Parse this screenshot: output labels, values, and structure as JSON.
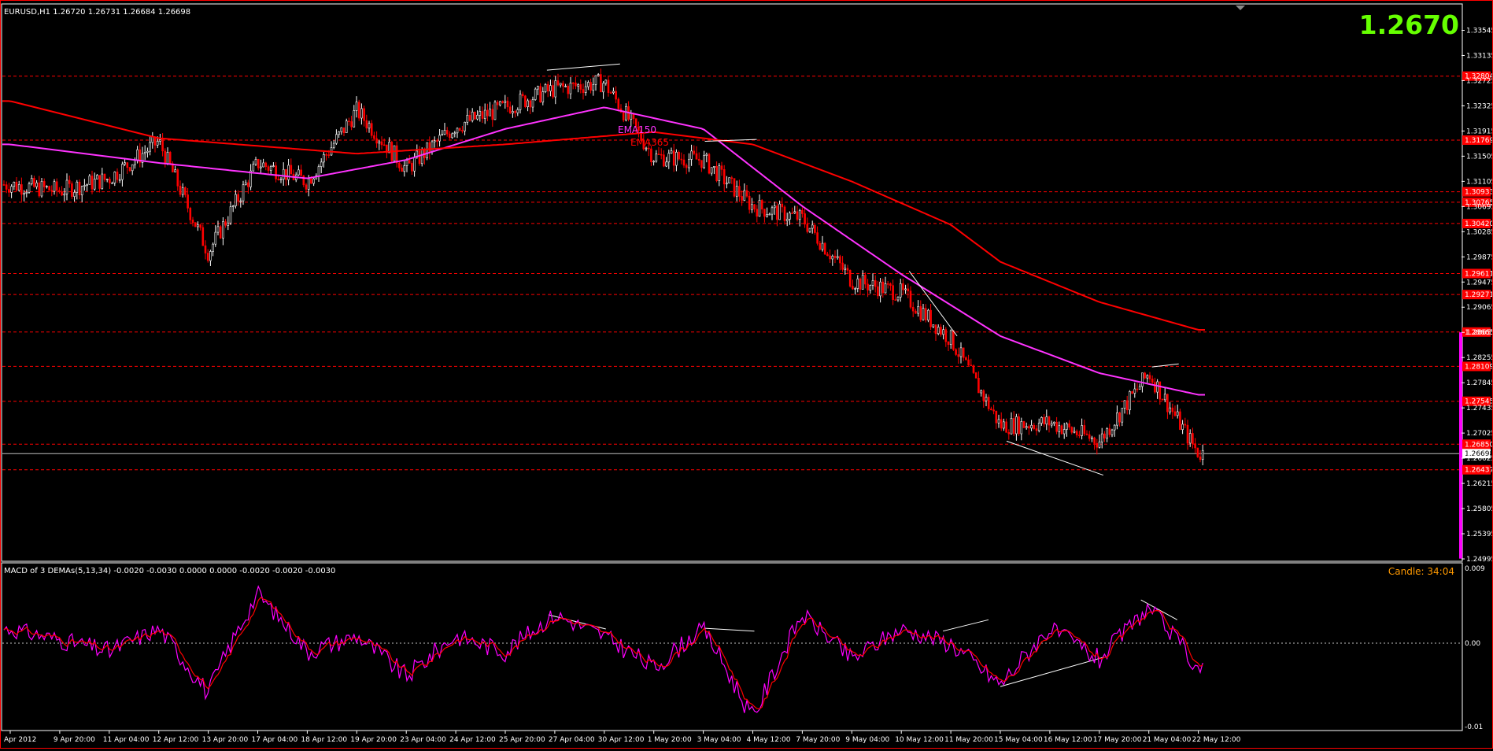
{
  "header": {
    "symbol_info": "EURUSD,H1  1.26720 1.26731 1.26684 1.26698",
    "big_price": "1.2670",
    "big_price_color": "#66ff00"
  },
  "price_axis": {
    "labels": [
      "1.33545",
      "1.33135",
      "1.32725",
      "1.32325",
      "1.31915",
      "1.31505",
      "1.31105",
      "1.30695",
      "1.30285",
      "1.29875",
      "1.29475",
      "1.29065",
      "1.28655",
      "1.28255",
      "1.27845",
      "1.27435",
      "1.27025",
      "1.26625",
      "1.26215",
      "1.25805",
      "1.25395",
      "1.24995"
    ],
    "line_labels": [
      "1.32804",
      "1.31769",
      "1.30933",
      "1.30765",
      "1.30420",
      "1.29611",
      "1.29271",
      "1.28665",
      "1.28109",
      "1.27545",
      "1.26850",
      "1.26437"
    ],
    "current_label": "1.26698"
  },
  "emas": [
    {
      "label": "EMA150",
      "color": "#ff33ff"
    },
    {
      "label": "EMA365",
      "color": "#ff0000"
    }
  ],
  "macd_panel": {
    "title": "MACD of 3 DEMAs(5,13,34) -0.0020 -0.0030 0.0000 0.0000 -0.0020 -0.0020 -0.0030",
    "candle_timer": "Candle:  34:04",
    "candle_timer_color": "#ff9900",
    "axis_labels": [
      "0.009",
      "0.00",
      "-0.01"
    ]
  },
  "time_axis": {
    "labels": [
      "Apr 2012",
      "9 Apr 20:00",
      "11 Apr 04:00",
      "12 Apr 12:00",
      "13 Apr 20:00",
      "17 Apr 04:00",
      "18 Apr 12:00",
      "19 Apr 20:00",
      "23 Apr 04:00",
      "24 Apr 12:00",
      "25 Apr 20:00",
      "27 Apr 04:00",
      "30 Apr 12:00",
      "1 May 20:00",
      "3 May 04:00",
      "4 May 12:00",
      "7 May 20:00",
      "9 May 04:00",
      "10 May 12:00",
      "11 May 20:00",
      "15 May 04:00",
      "16 May 12:00",
      "17 May 20:00",
      "21 May 04:00",
      "22 May 12:00"
    ]
  },
  "chart_data": {
    "type": "candlestick",
    "symbol": "EURUSD",
    "timeframe": "H1",
    "last_price": 1.26698,
    "ohlc_last": {
      "open": 1.2672,
      "high": 1.26731,
      "low": 1.26684,
      "close": 1.26698
    },
    "ylim": [
      1.24995,
      1.33545
    ],
    "close_path": [
      {
        "x": "Apr 2012",
        "y": 1.3105
      },
      {
        "x": "9 Apr 20:00",
        "y": 1.3095
      },
      {
        "x": "11 Apr 04:00",
        "y": 1.3115
      },
      {
        "x": "12 Apr 12:00",
        "y": 1.3175
      },
      {
        "x": "13 Apr 20:00",
        "y": 1.2995
      },
      {
        "x": "17 Apr 04:00",
        "y": 1.314
      },
      {
        "x": "18 Apr 12:00",
        "y": 1.311
      },
      {
        "x": "19 Apr 20:00",
        "y": 1.3225
      },
      {
        "x": "23 Apr 04:00",
        "y": 1.313
      },
      {
        "x": "24 Apr 12:00",
        "y": 1.32
      },
      {
        "x": "25 Apr 20:00",
        "y": 1.323
      },
      {
        "x": "27 Apr 04:00",
        "y": 1.326
      },
      {
        "x": "30 Apr 12:00",
        "y": 1.327
      },
      {
        "x": "1 May 20:00",
        "y": 1.315
      },
      {
        "x": "3 May 04:00",
        "y": 1.3145
      },
      {
        "x": "4 May 12:00",
        "y": 1.307
      },
      {
        "x": "7 May 20:00",
        "y": 1.305
      },
      {
        "x": "9 May 04:00",
        "y": 1.295
      },
      {
        "x": "10 May 12:00",
        "y": 1.293
      },
      {
        "x": "11 May 20:00",
        "y": 1.2855
      },
      {
        "x": "15 May 04:00",
        "y": 1.2715
      },
      {
        "x": "16 May 12:00",
        "y": 1.272
      },
      {
        "x": "17 May 20:00",
        "y": 1.269
      },
      {
        "x": "21 May 04:00",
        "y": 1.28
      },
      {
        "x": "22 May 12:00",
        "y": 1.267
      }
    ],
    "series": [
      {
        "name": "EMA150",
        "points": [
          {
            "x": "Apr 2012",
            "y": 1.317
          },
          {
            "x": "12 Apr 12:00",
            "y": 1.314
          },
          {
            "x": "18 Apr 12:00",
            "y": 1.3115
          },
          {
            "x": "23 Apr 04:00",
            "y": 1.3145
          },
          {
            "x": "25 Apr 20:00",
            "y": 1.3195
          },
          {
            "x": "30 Apr 12:00",
            "y": 1.323
          },
          {
            "x": "3 May 04:00",
            "y": 1.3195
          },
          {
            "x": "7 May 20:00",
            "y": 1.307
          },
          {
            "x": "10 May 12:00",
            "y": 1.296
          },
          {
            "x": "15 May 04:00",
            "y": 1.286
          },
          {
            "x": "17 May 20:00",
            "y": 1.28
          },
          {
            "x": "22 May 12:00",
            "y": 1.2765
          }
        ]
      },
      {
        "name": "EMA365",
        "points": [
          {
            "x": "Apr 2012",
            "y": 1.324
          },
          {
            "x": "12 Apr 12:00",
            "y": 1.318
          },
          {
            "x": "19 Apr 20:00",
            "y": 1.3155
          },
          {
            "x": "25 Apr 20:00",
            "y": 1.317
          },
          {
            "x": "1 May 20:00",
            "y": 1.319
          },
          {
            "x": "4 May 12:00",
            "y": 1.317
          },
          {
            "x": "9 May 04:00",
            "y": 1.311
          },
          {
            "x": "11 May 20:00",
            "y": 1.304
          },
          {
            "x": "15 May 04:00",
            "y": 1.298
          },
          {
            "x": "17 May 20:00",
            "y": 1.2915
          },
          {
            "x": "22 May 12:00",
            "y": 1.287
          }
        ]
      }
    ],
    "macd": {
      "name": "MACD of 3 DEMAs(5,13,34)",
      "values_shown": [
        -0.002,
        -0.003,
        0.0,
        0.0,
        -0.002,
        -0.002,
        -0.003
      ],
      "ylim": [
        -0.01,
        0.009
      ],
      "path": [
        {
          "x": "Apr 2012",
          "y": 0.002
        },
        {
          "x": "9 Apr 20:00",
          "y": 0.0005
        },
        {
          "x": "11 Apr 04:00",
          "y": -0.001
        },
        {
          "x": "12 Apr 12:00",
          "y": 0.002
        },
        {
          "x": "13 Apr 20:00",
          "y": -0.006
        },
        {
          "x": "17 Apr 04:00",
          "y": 0.007
        },
        {
          "x": "18 Apr 12:00",
          "y": -0.001
        },
        {
          "x": "19 Apr 20:00",
          "y": 0.001
        },
        {
          "x": "23 Apr 04:00",
          "y": -0.004
        },
        {
          "x": "24 Apr 12:00",
          "y": 0.001
        },
        {
          "x": "25 Apr 20:00",
          "y": -0.001
        },
        {
          "x": "27 Apr 04:00",
          "y": 0.004
        },
        {
          "x": "30 Apr 12:00",
          "y": 0.001
        },
        {
          "x": "1 May 20:00",
          "y": -0.003
        },
        {
          "x": "3 May 04:00",
          "y": 0.002
        },
        {
          "x": "4 May 12:00",
          "y": -0.009
        },
        {
          "x": "7 May 20:00",
          "y": 0.004
        },
        {
          "x": "9 May 04:00",
          "y": -0.002
        },
        {
          "x": "10 May 12:00",
          "y": 0.002
        },
        {
          "x": "11 May 20:00",
          "y": 0.0
        },
        {
          "x": "15 May 04:00",
          "y": -0.005
        },
        {
          "x": "16 May 12:00",
          "y": 0.002
        },
        {
          "x": "17 May 20:00",
          "y": -0.002
        },
        {
          "x": "21 May 04:00",
          "y": 0.005
        },
        {
          "x": "22 May 12:00",
          "y": -0.003
        }
      ]
    }
  }
}
